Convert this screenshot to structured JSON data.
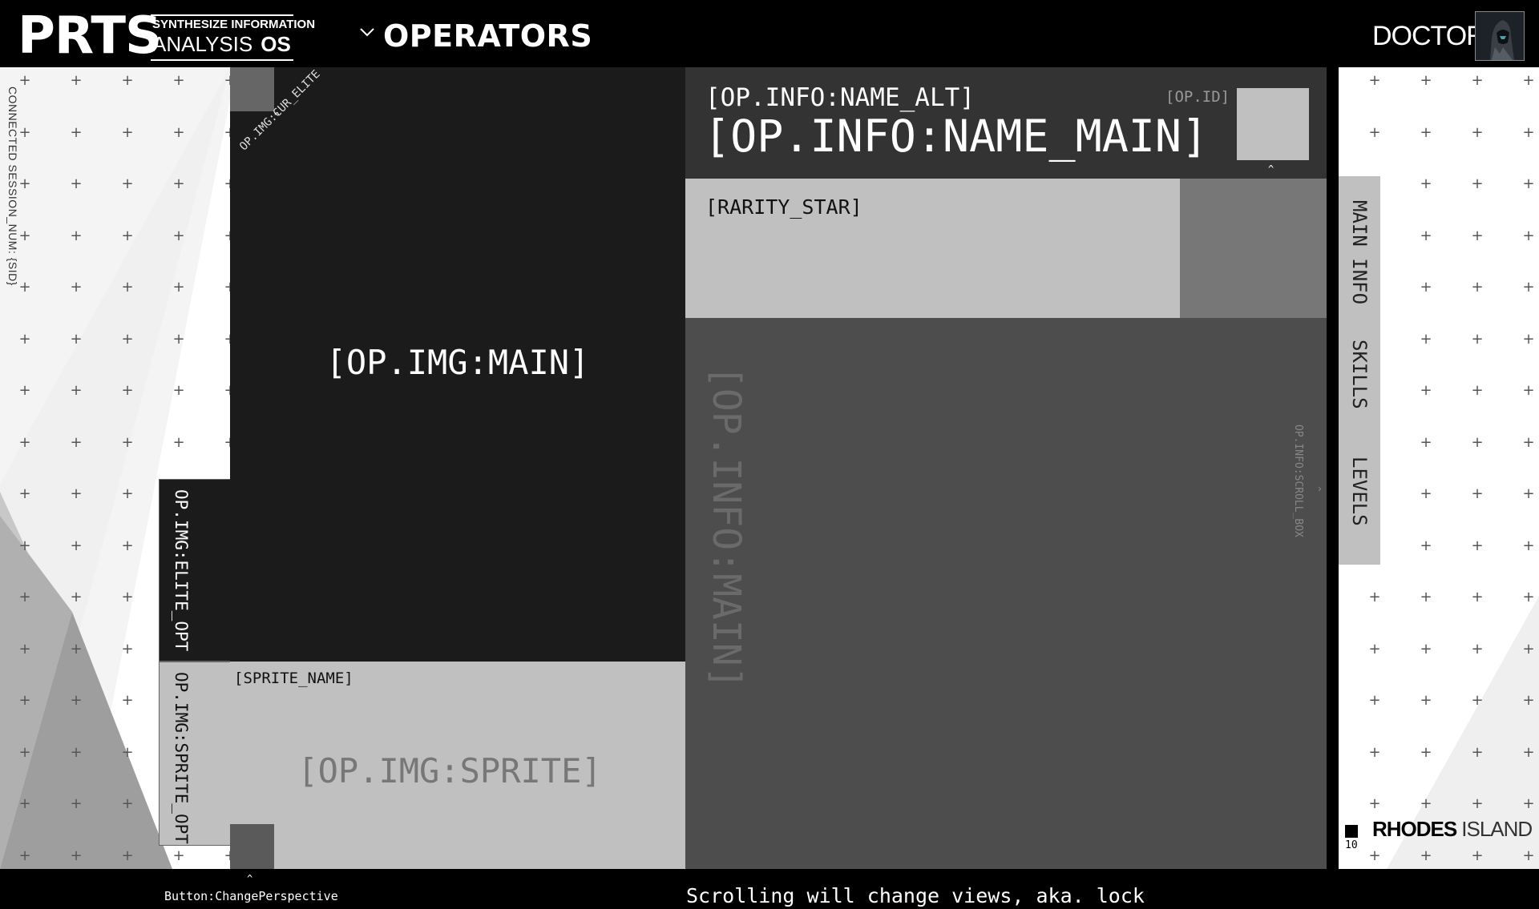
{
  "header": {
    "logo": "PRTS",
    "logo_sub1": "SYNTHESIZE INFORMATION",
    "logo_sub2": "ANALYSIS",
    "logo_sub3": "OS",
    "nav_title": "OPERATORS",
    "user_label": "DOCTOR"
  },
  "left_panel": {
    "session_text": "CONNECTED SESSION_NUM: {SID}",
    "elite_opt": "OP.IMG:ELITE_OPT",
    "sprite_opt": "OP.IMG:SPRITE_OPT"
  },
  "main_image": {
    "cur_elite_label": "OP.IMG:CUR_ELITE",
    "caret": "^",
    "label": "[OP.IMG:MAIN]"
  },
  "sprite": {
    "name": "[SPRITE_NAME]",
    "label": "[OP.IMG:SPRITE]",
    "perspective_button_label": "Button:ChangePerspective"
  },
  "info": {
    "name_alt": "[OP.INFO:NAME_ALT]",
    "name_main": "[OP.INFO:NAME_MAIN]",
    "op_id": "[OP.ID]",
    "op_icon_label": "op_icon",
    "rarity": "[RARITY_STAR]",
    "main_label": "[OP.INFO:MAIN]",
    "scroll_label": "OP.INFO:SCROLL_BOX"
  },
  "side_tabs": {
    "items": [
      {
        "label": "MAIN INFO"
      },
      {
        "label": "SKILLS"
      },
      {
        "label": "LEVELS"
      }
    ]
  },
  "branding": {
    "ri_bold": "RHODES",
    "ri_light": "ISLAND",
    "ri_num": "10"
  },
  "footer": {
    "note": "Scrolling will change views, aka. lock"
  },
  "colors": {
    "background": "#000000",
    "panel_dark": "#1b1b1b",
    "panel_mid": "#4d4d4d",
    "panel_light": "#c0c0c0",
    "accent_text": "#ffffff"
  }
}
